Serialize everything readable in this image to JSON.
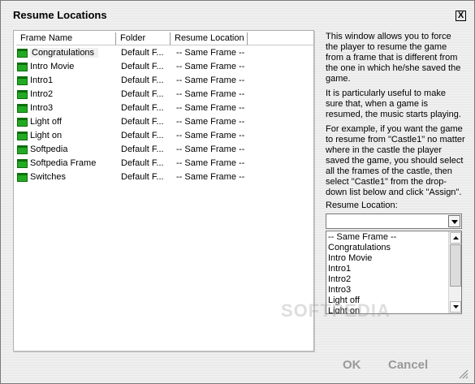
{
  "window": {
    "title": "Resume Locations",
    "close_label": "X"
  },
  "list": {
    "columns": [
      "Frame Name",
      "Folder",
      "Resume Location"
    ],
    "rows": [
      {
        "name": "Congratulations",
        "folder": "Default F...",
        "resume": "-- Same Frame --",
        "selected": true
      },
      {
        "name": "Intro Movie",
        "folder": "Default F...",
        "resume": "-- Same Frame --"
      },
      {
        "name": "Intro1",
        "folder": "Default F...",
        "resume": "-- Same Frame --"
      },
      {
        "name": "Intro2",
        "folder": "Default F...",
        "resume": "-- Same Frame --"
      },
      {
        "name": "Intro3",
        "folder": "Default F...",
        "resume": "-- Same Frame --"
      },
      {
        "name": "Light off",
        "folder": "Default F...",
        "resume": "-- Same Frame --"
      },
      {
        "name": "Light on",
        "folder": "Default F...",
        "resume": "-- Same Frame --"
      },
      {
        "name": "Softpedia",
        "folder": "Default F...",
        "resume": "-- Same Frame --"
      },
      {
        "name": "Softpedia Frame",
        "folder": "Default F...",
        "resume": "-- Same Frame --"
      },
      {
        "name": "Switches",
        "folder": "Default F...",
        "resume": "-- Same Frame --"
      }
    ],
    "row_icon": "frame-icon",
    "icon_color": "#22aa22"
  },
  "description": {
    "p1": "This window allows you to force the player to resume the game from a frame that is different from the one in which he/she saved the game.",
    "p2": "It is particularly useful to make sure that, when a game is resumed, the music starts playing.",
    "p3": "For example, if you want the game to resume from \"Castle1\" no matter where in the castle the player saved the game, you should select all the frames of the castle, then select \"Castle1\" from the drop-down list below and click \"Assign\"."
  },
  "resume_location": {
    "label": "Resume Location:",
    "selected_value": "",
    "options": [
      "-- Same Frame --",
      "Congratulations",
      "Intro Movie",
      "Intro1",
      "Intro2",
      "Intro3",
      "Light off",
      "Light on"
    ]
  },
  "buttons": {
    "ok": "OK",
    "cancel": "Cancel"
  },
  "watermark": "SOFTPEDIA"
}
